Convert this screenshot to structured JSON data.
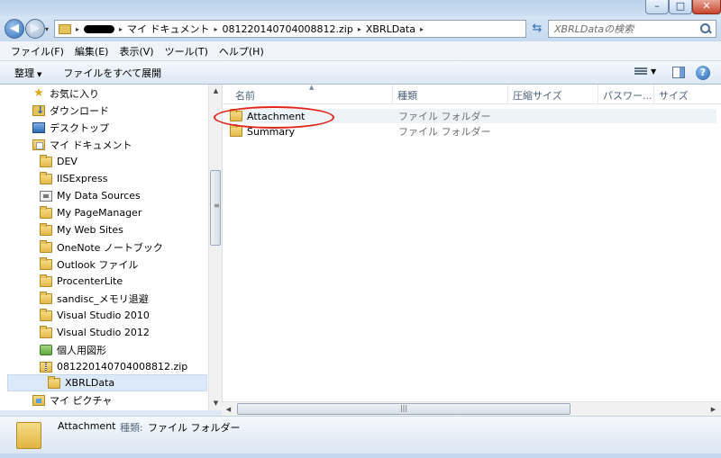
{
  "window": {
    "min_glyph": "–",
    "max_glyph": "□",
    "close_glyph": "✕"
  },
  "address": {
    "crumbs": [
      "マイ ドキュメント",
      "081220140704008812.zip",
      "XBRLData"
    ],
    "separator": "▸",
    "dropdown": "▾"
  },
  "search": {
    "placeholder": "XBRLDataの検索"
  },
  "menu": [
    "ファイル(F)",
    "編集(E)",
    "表示(V)",
    "ツール(T)",
    "ヘルプ(H)"
  ],
  "commands": {
    "organize": "整理",
    "organize_caret": "▼",
    "extract_all": "ファイルをすべて展開",
    "views_caret": "▼",
    "help_glyph": "?"
  },
  "nav": {
    "items": [
      {
        "label": "お気に入り",
        "icon": "star-icon"
      },
      {
        "label": "ダウンロード",
        "icon": "download-folder-icon"
      },
      {
        "label": "デスクトップ",
        "icon": "desktop-icon"
      },
      {
        "label": "マイ ドキュメント",
        "icon": "documents-icon"
      },
      {
        "label": "DEV",
        "icon": "folder-icon"
      },
      {
        "label": "IISExpress",
        "icon": "folder-icon"
      },
      {
        "label": "My Data Sources",
        "icon": "data-sources-icon"
      },
      {
        "label": "My PageManager",
        "icon": "folder-icon"
      },
      {
        "label": "My Web Sites",
        "icon": "folder-icon"
      },
      {
        "label": "OneNote ノートブック",
        "icon": "folder-icon"
      },
      {
        "label": "Outlook ファイル",
        "icon": "folder-icon"
      },
      {
        "label": "ProcenterLite",
        "icon": "folder-icon"
      },
      {
        "label": "sandisc_メモリ退避",
        "icon": "folder-icon"
      },
      {
        "label": "Visual Studio 2010",
        "icon": "folder-icon"
      },
      {
        "label": "Visual Studio 2012",
        "icon": "folder-icon"
      },
      {
        "label": "個人用図形",
        "icon": "shapes-icon"
      },
      {
        "label": "081220140704008812.zip",
        "icon": "zip-folder-icon"
      },
      {
        "label": "XBRLData",
        "icon": "folder-icon"
      },
      {
        "label": "マイ ピクチャ",
        "icon": "pictures-icon"
      }
    ],
    "selected_index": 17
  },
  "columns": {
    "name": "名前",
    "type": "種類",
    "compressed_size": "圧縮サイズ",
    "password": "パスワー...",
    "size": "サイズ"
  },
  "files": [
    {
      "name": "Attachment",
      "type": "ファイル フォルダー"
    },
    {
      "name": "Summary",
      "type": "ファイル フォルダー"
    }
  ],
  "details": {
    "name": "Attachment",
    "type_label": "種類:",
    "type_value": "ファイル フォルダー"
  },
  "scroll": {
    "up": "▲",
    "down": "▼",
    "left": "◀",
    "right": "▶",
    "grip": "≡",
    "h_grip": "|||"
  },
  "colors": {
    "accent": "#2d6bb5",
    "annotation": "#e0261a",
    "folder": "#e6c25a"
  }
}
